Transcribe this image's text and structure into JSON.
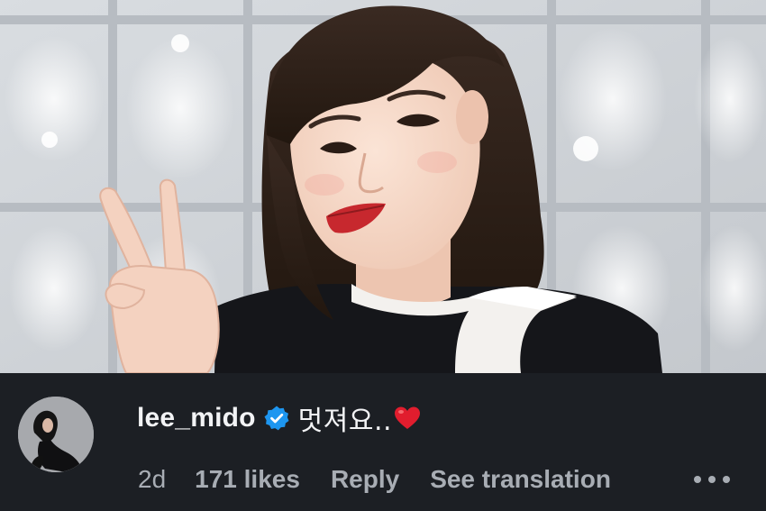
{
  "comment": {
    "username": "lee_mido",
    "verified": true,
    "text": "멋져요..",
    "time": "2d",
    "likes": "171 likes",
    "reply_label": "Reply",
    "translate_label": "See translation"
  },
  "icons": {
    "verified": "verified-badge-icon",
    "heart": "red-heart-emoji",
    "more": "more-options-icon"
  },
  "colors": {
    "background": "#1c1f24",
    "primary_text": "#f2f3f5",
    "secondary_text": "#a8adb4",
    "verified_blue": "#1d96f0",
    "heart_red": "#e11d2e"
  }
}
